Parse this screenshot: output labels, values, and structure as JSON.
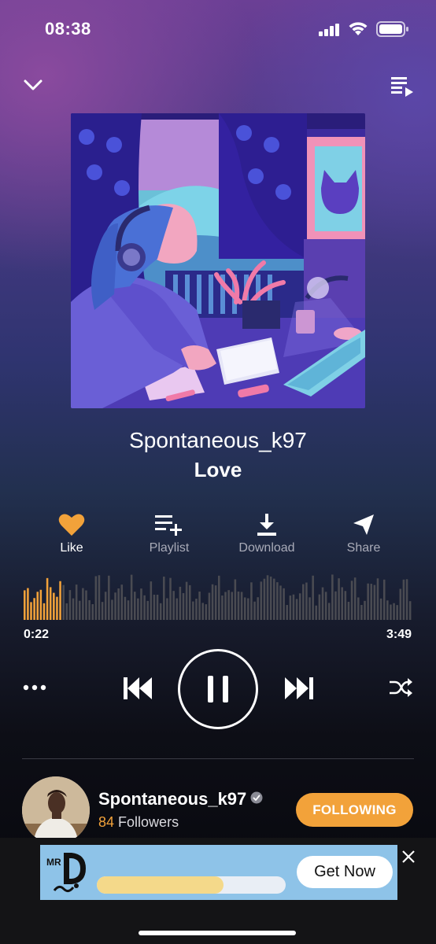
{
  "status_bar": {
    "time": "08:38",
    "icons": [
      "cellular-signal-icon",
      "wifi-icon",
      "battery-icon"
    ]
  },
  "header": {
    "icons": [
      "chevron-down-icon",
      "queue-icon"
    ]
  },
  "track": {
    "artist": "Spontaneous_k97",
    "title": "Love"
  },
  "actions": [
    {
      "label": "Like",
      "icon": "heart-icon",
      "active": true,
      "color": "#f2a23a"
    },
    {
      "label": "Playlist",
      "icon": "playlist-add-icon"
    },
    {
      "label": "Download",
      "icon": "download-icon"
    },
    {
      "label": "Share",
      "icon": "share-icon"
    }
  ],
  "progress": {
    "current": "0:22",
    "total": "3:49",
    "fraction": 0.096
  },
  "controls": {
    "icons": [
      "more-icon",
      "previous-icon",
      "pause-icon",
      "next-icon",
      "shuffle-icon"
    ]
  },
  "uploader": {
    "name": "Spontaneous_k97",
    "followers_count": "84",
    "followers_label": "Followers",
    "follow_label": "FOLLOWING"
  },
  "ad": {
    "logo_text": "MR D",
    "button_label": "Get Now",
    "progress_fraction": 0.67
  },
  "colors": {
    "accent": "#f2a23a",
    "waveform_inactive": "#4a4b52",
    "ad_background": "#8ec3e8"
  }
}
